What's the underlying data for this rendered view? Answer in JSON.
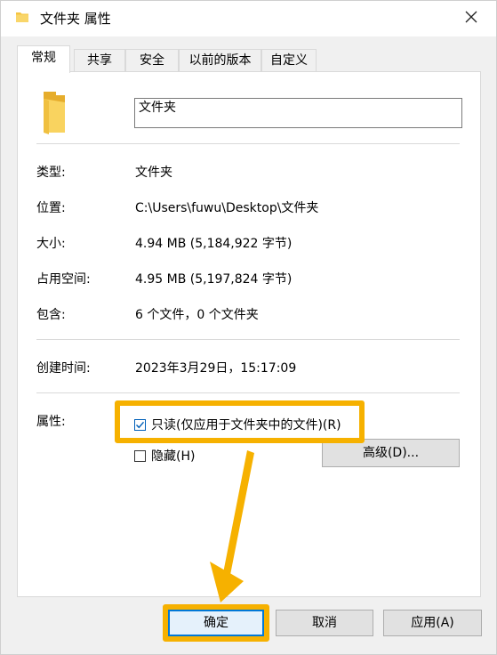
{
  "window": {
    "title": "文件夹 属性",
    "close_icon": "close-icon"
  },
  "tabs": [
    {
      "label": "常规",
      "active": true
    },
    {
      "label": "共享",
      "active": false
    },
    {
      "label": "安全",
      "active": false
    },
    {
      "label": "以前的版本",
      "active": false
    },
    {
      "label": "自定义",
      "active": false
    }
  ],
  "general": {
    "name_value": "文件夹",
    "rows": [
      {
        "label": "类型:",
        "value": "文件夹"
      },
      {
        "label": "位置:",
        "value": "C:\\Users\\fuwu\\Desktop\\文件夹"
      },
      {
        "label": "大小:",
        "value": "4.94 MB (5,184,922 字节)"
      },
      {
        "label": "占用空间:",
        "value": "4.95 MB (5,197,824 字节)"
      },
      {
        "label": "包含:",
        "value": "6 个文件，0 个文件夹"
      }
    ],
    "created_label": "创建时间:",
    "created_value": "2023年3月29日，15:17:09",
    "attributes_label": "属性:",
    "readonly_label": "只读(仅应用于文件夹中的文件)(R)",
    "readonly_checked": true,
    "hidden_label": "隐藏(H)",
    "hidden_checked": false,
    "advanced_button": "高级(D)..."
  },
  "buttons": {
    "ok": "确定",
    "cancel": "取消",
    "apply": "应用(A)"
  },
  "colors": {
    "highlight": "#f6b100",
    "folder": "#f5c542",
    "focus": "#0078d7"
  }
}
